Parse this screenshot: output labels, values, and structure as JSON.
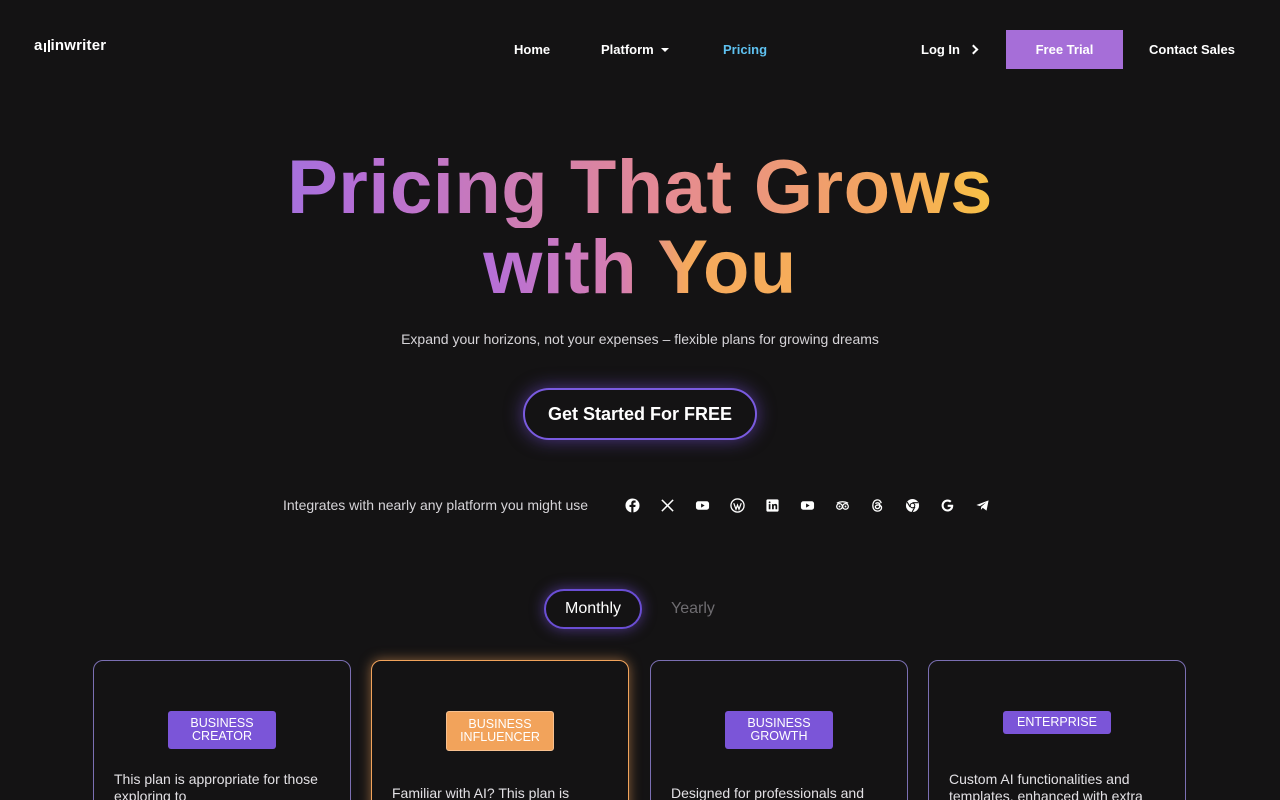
{
  "nav": {
    "logo_text_a": "a",
    "logo_text_b": "inwriter",
    "home": "Home",
    "platform": "Platform",
    "pricing": "Pricing",
    "login": "Log In",
    "free_trial": "Free Trial",
    "contact_sales": "Contact Sales",
    "active_color": "#5ec1f0",
    "trial_color": "#a66ed8"
  },
  "hero": {
    "title_line1": "Pricing That Grows",
    "title_line2": "with You",
    "subtitle": "Expand your horizons, not your expenses – flexible plans for growing dreams",
    "cta": "Get Started For FREE"
  },
  "integrations": {
    "label": "Integrates with nearly any platform you might use",
    "icons": [
      "facebook-icon",
      "x-icon",
      "youtube-icon",
      "wordpress-icon",
      "linkedin-icon",
      "youtube-icon",
      "tripadvisor-icon",
      "threads-icon",
      "chrome-icon",
      "google-icon",
      "telegram-icon"
    ]
  },
  "billing": {
    "monthly": "Monthly",
    "yearly": "Yearly",
    "selected": "Monthly"
  },
  "plans": [
    {
      "badge_line1": "BUSINESS",
      "badge_line2": "CREATOR",
      "desc_line1": "This plan is appropriate for those",
      "desc_line2": "exploring to"
    },
    {
      "badge_line1": "BUSINESS",
      "badge_line2": "INFLUENCER",
      "desc_line1": "Familiar with AI? This plan is",
      "desc_line2": ""
    },
    {
      "badge_line1": "BUSINESS",
      "badge_line2": "GROWTH",
      "desc_line1": "Designed for professionals and",
      "desc_line2": ""
    },
    {
      "badge_line1": "ENTERPRISE",
      "badge_line2": "",
      "desc_line1": "Custom AI functionalities and",
      "desc_line2": "templates, enhanced with extra"
    }
  ]
}
